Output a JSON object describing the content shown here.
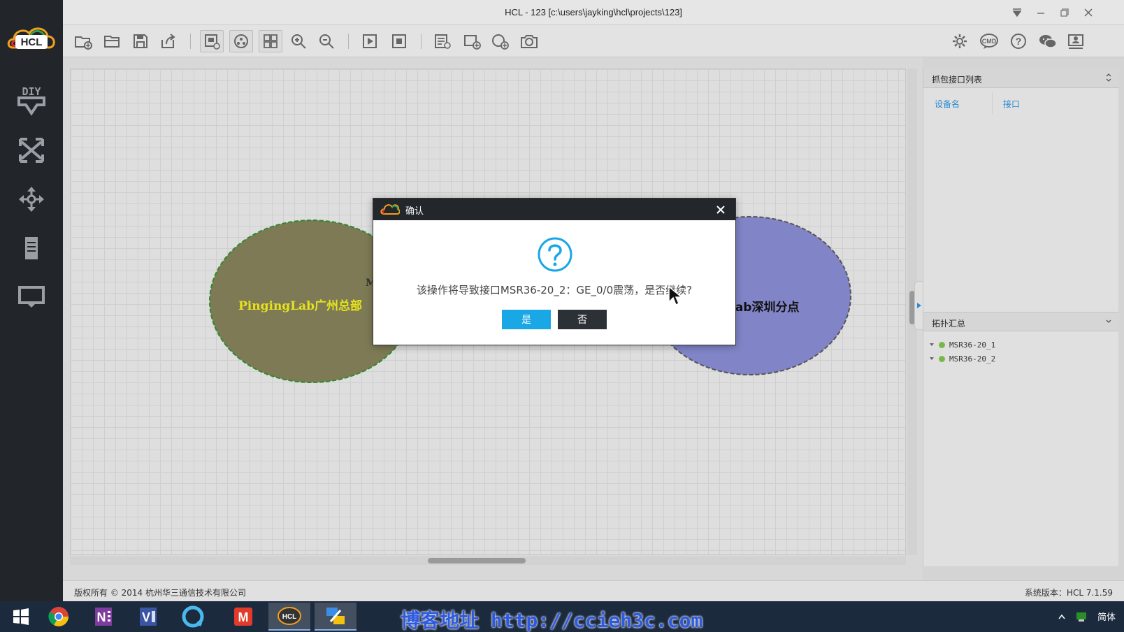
{
  "window": {
    "title": "HCL - 123 [c:\\users\\jayking\\hcl\\projects\\123]"
  },
  "logo": {
    "text": "HCL"
  },
  "sidebar": {
    "items": [
      {
        "name": "diy",
        "label": "DIY"
      },
      {
        "name": "switch",
        "label": ""
      },
      {
        "name": "router",
        "label": ""
      },
      {
        "name": "server",
        "label": ""
      },
      {
        "name": "terminal",
        "label": ""
      }
    ]
  },
  "canvas": {
    "left_area_label": "PingingLab广州总部",
    "left_area_partial_text": "M",
    "right_area_label": "Lab深圳分点",
    "left_area_color": "#7d7a55",
    "right_area_color": "#8185c8"
  },
  "right_panel": {
    "capture_title": "抓包接口列表",
    "col_device": "设备名",
    "col_interface": "接口",
    "topology_title": "拓扑汇总",
    "devices": [
      "MSR36-20_1",
      "MSR36-20_2"
    ]
  },
  "statusbar": {
    "copyright": "版权所有 © 2014 杭州华三通信技术有限公司",
    "version": "系统版本：HCL 7.1.59"
  },
  "dialog": {
    "title": "确认",
    "message": "该操作将导致接口MSR36-20_2：GE_0/0震荡，是否继续?",
    "yes_label": "是",
    "no_label": "否"
  },
  "taskbar": {
    "blog_text": "博客地址 http://ccieh3c.com",
    "ime_label": "简体",
    "apps": [
      "start",
      "chrome",
      "onenote",
      "visio",
      "browser",
      "mindmanager",
      "hcl",
      "network-tool"
    ]
  },
  "colors": {
    "accent": "#1aa7e6",
    "sidebar_bg": "#22262b",
    "device_status": "#7ab845"
  }
}
